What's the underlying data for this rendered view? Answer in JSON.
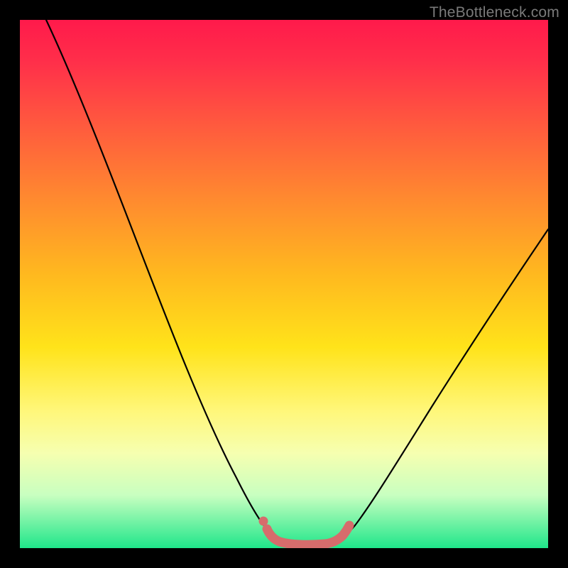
{
  "watermark": "TheBottleneck.com",
  "chart_data": {
    "type": "line",
    "title": "",
    "xlabel": "",
    "ylabel": "",
    "xlim": [
      0,
      100
    ],
    "ylim": [
      0,
      100
    ],
    "grid": false,
    "legend": false,
    "series": [
      {
        "name": "bottleneck-curve",
        "color": "#000000",
        "x": [
          5,
          10,
          15,
          20,
          25,
          30,
          35,
          40,
          43,
          46,
          48,
          50,
          52,
          55,
          57,
          60,
          65,
          70,
          75,
          80,
          85,
          90,
          95
        ],
        "y": [
          100,
          89,
          78,
          67,
          56,
          45,
          34,
          23,
          15,
          9,
          5,
          3,
          2,
          2,
          2,
          4,
          10,
          19,
          28,
          37,
          46,
          55,
          63
        ]
      },
      {
        "name": "optimal-range-highlight",
        "color": "#d66c6c",
        "x": [
          46,
          48,
          50,
          52,
          54,
          56,
          58
        ],
        "y": [
          5,
          3,
          2,
          2,
          2,
          2,
          4
        ]
      }
    ],
    "markers": [
      {
        "name": "optimal-point-marker",
        "x": 46,
        "y": 6,
        "color": "#d66c6c"
      }
    ],
    "gradient_stops": [
      {
        "pos": 0,
        "color": "#ff1a4b"
      },
      {
        "pos": 20,
        "color": "#ff5a3e"
      },
      {
        "pos": 48,
        "color": "#ffb81f"
      },
      {
        "pos": 74,
        "color": "#fff77a"
      },
      {
        "pos": 90,
        "color": "#c8ffc0"
      },
      {
        "pos": 100,
        "color": "#1fe68a"
      }
    ]
  }
}
